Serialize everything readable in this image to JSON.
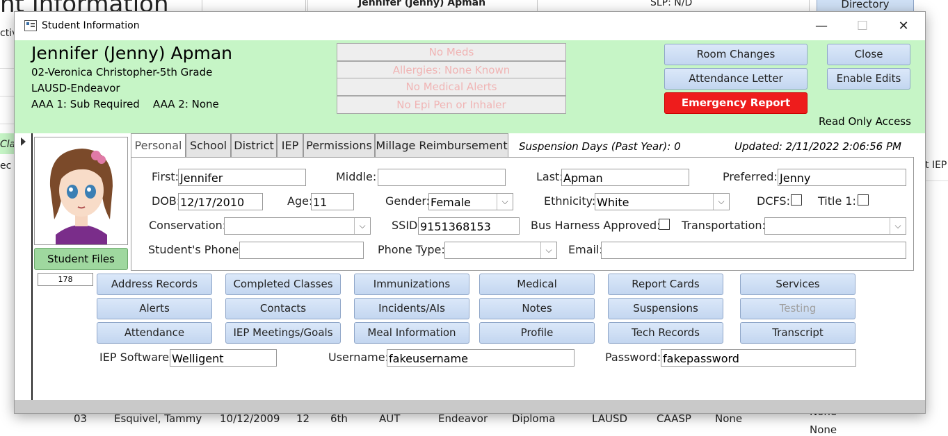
{
  "background": {
    "title": "nt Information",
    "top_name": "Jennifer (Jenny) Apman",
    "slp": "SLP: N/D",
    "directory_button": "Directory",
    "left_fragments": [
      "ctiv",
      "Clas",
      "ec"
    ],
    "right_fragment": "t IEP",
    "row": {
      "num": "03",
      "name": "Esquivel, Tammy",
      "dob": "10/12/2009",
      "age": "12",
      "grade": "6th",
      "disability": "AUT",
      "school": "Endeavor",
      "track": "Diploma",
      "district": "LAUSD",
      "test": "CAASP",
      "col1": "None",
      "col2_top": "None",
      "col2_bottom": "None"
    }
  },
  "window": {
    "title": "Student Information",
    "minimize": "—",
    "maximize": "☐",
    "close": "✕"
  },
  "header": {
    "name": "Jennifer (Jenny) Apman",
    "class_line": "02-Veronica Christopher-5th Grade",
    "school_line": "LAUSD-Endeavor",
    "aaa_line": "AAA 1: Sub Required    AAA 2: None",
    "alerts": [
      "No Meds",
      "Allergies: None Known",
      "No Medical Alerts",
      "No Epi Pen or Inhaler"
    ],
    "buttons": {
      "room_changes": "Room Changes",
      "attendance_letter": "Attendance Letter",
      "emergency_report": "Emergency Report",
      "close": "Close",
      "enable_edits": "Enable Edits"
    },
    "access": "Read Only Access"
  },
  "sidebar": {
    "student_files": "Student Files",
    "record_id": "178"
  },
  "tabs": [
    "Personal",
    "School",
    "District",
    "IEP",
    "Permissions",
    "Millage Reimbursement"
  ],
  "suspension_days": "Suspension Days (Past Year): 0",
  "updated": "Updated: 2/11/2022 2:06:56 PM",
  "personal": {
    "first_label": "First:",
    "first": "Jennifer",
    "middle_label": "Middle:",
    "middle": "",
    "last_label": "Last:",
    "last": "Apman",
    "preferred_label": "Preferred:",
    "preferred": "Jenny",
    "dob_label": "DOB:",
    "dob": "12/17/2010",
    "age_label": "Age:",
    "age": "11",
    "gender_label": "Gender:",
    "gender": "Female",
    "ethnicity_label": "Ethnicity:",
    "ethnicity": "White",
    "dcfs_label": "DCFS:",
    "title1_label": "Title 1:",
    "conservation_label": "Conservation:",
    "conservation": "",
    "ssid_label": "SSID:",
    "ssid": "9151368153",
    "bus_label": "Bus Harness Approved:",
    "transportation_label": "Transportation:",
    "transportation": "",
    "phone_label": "Student's Phone:",
    "phone": "",
    "phone_type_label": "Phone Type:",
    "phone_type": "",
    "email_label": "Email:",
    "email": ""
  },
  "record_buttons": [
    [
      "Address Records",
      "Completed Classes",
      "Immunizations",
      "Medical",
      "Report Cards",
      "Services"
    ],
    [
      "Alerts",
      "Contacts",
      "Incidents/AIs",
      "Notes",
      "Suspensions",
      "Testing"
    ],
    [
      "Attendance",
      "IEP Meetings/Goals",
      "Meal Information",
      "Profile",
      "Tech Records",
      "Transcript"
    ]
  ],
  "credentials": {
    "software_label": "IEP Software:",
    "software": "Welligent",
    "username_label": "Username:",
    "username": "fakeusername",
    "password_label": "Password:",
    "password": "fakepassword"
  },
  "colors": {
    "header_bg": "#c6f5c6",
    "emergency": "#ee1c1c",
    "button": "#c9dbf3",
    "student_files": "#9fd89f"
  }
}
